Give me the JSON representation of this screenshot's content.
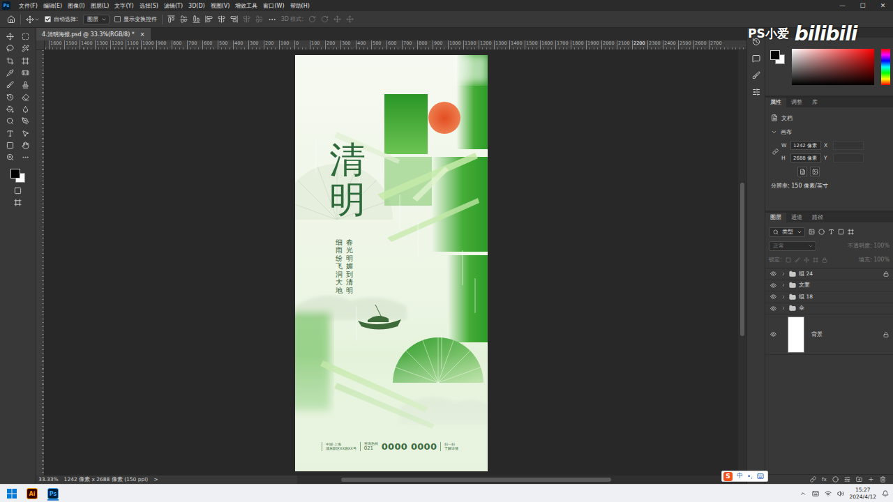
{
  "app_badge": "Ps",
  "menu": [
    "文件(F)",
    "编辑(E)",
    "图像(I)",
    "图层(L)",
    "文字(Y)",
    "选择(S)",
    "滤镜(T)",
    "3D(D)",
    "视图(V)",
    "增效工具",
    "窗口(W)",
    "帮助(H)"
  ],
  "window_controls": [
    "—",
    "☐",
    "✕"
  ],
  "options_bar": {
    "auto_select": {
      "label": "自动选择:",
      "checked": true
    },
    "auto_select_target": "图层",
    "show_transform": {
      "label": "显示变换控件",
      "checked": false
    },
    "mode_3d": "3D 模式:"
  },
  "document_tab": {
    "title": "4.清明海报.psd @ 33.3%(RGB/8) *",
    "close": "×",
    "selected": true
  },
  "ruler_labels": [
    "1600",
    "1500",
    "1400",
    "1300",
    "1200",
    "1100",
    "1000",
    "900",
    "800",
    "700",
    "600",
    "500",
    "400",
    "300",
    "200",
    "100",
    "0",
    "100",
    "200",
    "300",
    "400",
    "500",
    "600",
    "700",
    "800",
    "900",
    "1000",
    "1100",
    "1200",
    "1300",
    "1400",
    "1500",
    "1600",
    "1700",
    "1800",
    "1900",
    "2000",
    "2100",
    "2200",
    "2300",
    "2400",
    "2500",
    "2600",
    "2700"
  ],
  "poster": {
    "title": "清明",
    "lines": [
      "春光明媚到清明",
      "细雨纷飞润大地"
    ],
    "footer": {
      "address": [
        "中国·上海",
        "浦东新区XX路XX号"
      ],
      "hotline_label": "咨询热线",
      "area_code": "021",
      "phone": "0000 0000",
      "qr": [
        "扫一扫",
        "了解详情"
      ]
    }
  },
  "status_bar": {
    "zoom": "33.33%",
    "info": "1242 像素 x 2688 像素 (150 ppi)",
    "more": ">"
  },
  "watermark": {
    "channel": "PS小爱",
    "site": "bilibili"
  },
  "properties_panel": {
    "tabs": [
      {
        "label": "属性",
        "selected": true
      },
      {
        "label": "调整",
        "selected": false
      },
      {
        "label": "库",
        "selected": false
      }
    ],
    "target": "文档",
    "section": {
      "label": "画布",
      "expanded": true
    },
    "fields": [
      {
        "label": "W",
        "value": "1242 像素",
        "pair_label": "X"
      },
      {
        "label": "H",
        "value": "2688 像素",
        "pair_label": "Y"
      }
    ],
    "resolution": "分辨率: 150 像素/英寸"
  },
  "layers_panel": {
    "tabs": [
      {
        "label": "图层",
        "selected": true
      },
      {
        "label": "通道",
        "selected": false
      },
      {
        "label": "路径",
        "selected": false
      }
    ],
    "filter": "类型",
    "blend_mode": "正常",
    "opacity": "不透明度: 100%",
    "lock": "锁定:",
    "fill": "填充: 100%",
    "fx": "fx",
    "layers": [
      {
        "name": "组 24",
        "kind": "group",
        "visible": true,
        "locked": true,
        "expanded": false,
        "selected": false
      },
      {
        "name": "文案",
        "kind": "group",
        "visible": true,
        "locked": false,
        "expanded": false,
        "selected": false
      },
      {
        "name": "组 18",
        "kind": "group",
        "visible": true,
        "locked": false,
        "expanded": false,
        "selected": false
      },
      {
        "name": "伞",
        "kind": "group",
        "visible": true,
        "locked": false,
        "expanded": false,
        "selected": false
      },
      {
        "name": "背景",
        "kind": "image",
        "visible": true,
        "locked": true,
        "expanded": false,
        "selected": false
      }
    ]
  },
  "ime": {
    "logo": "S",
    "mode": "中",
    "punct": "•,"
  },
  "taskbar": {
    "apps": [
      {
        "label": "Ai",
        "color": "#ff9a00",
        "background": "#330000",
        "selected": false
      },
      {
        "label": "Ps",
        "color": "#31a8ff",
        "background": "#001e36",
        "selected": true
      }
    ],
    "time": "15:27",
    "date": "2024/4/12"
  }
}
